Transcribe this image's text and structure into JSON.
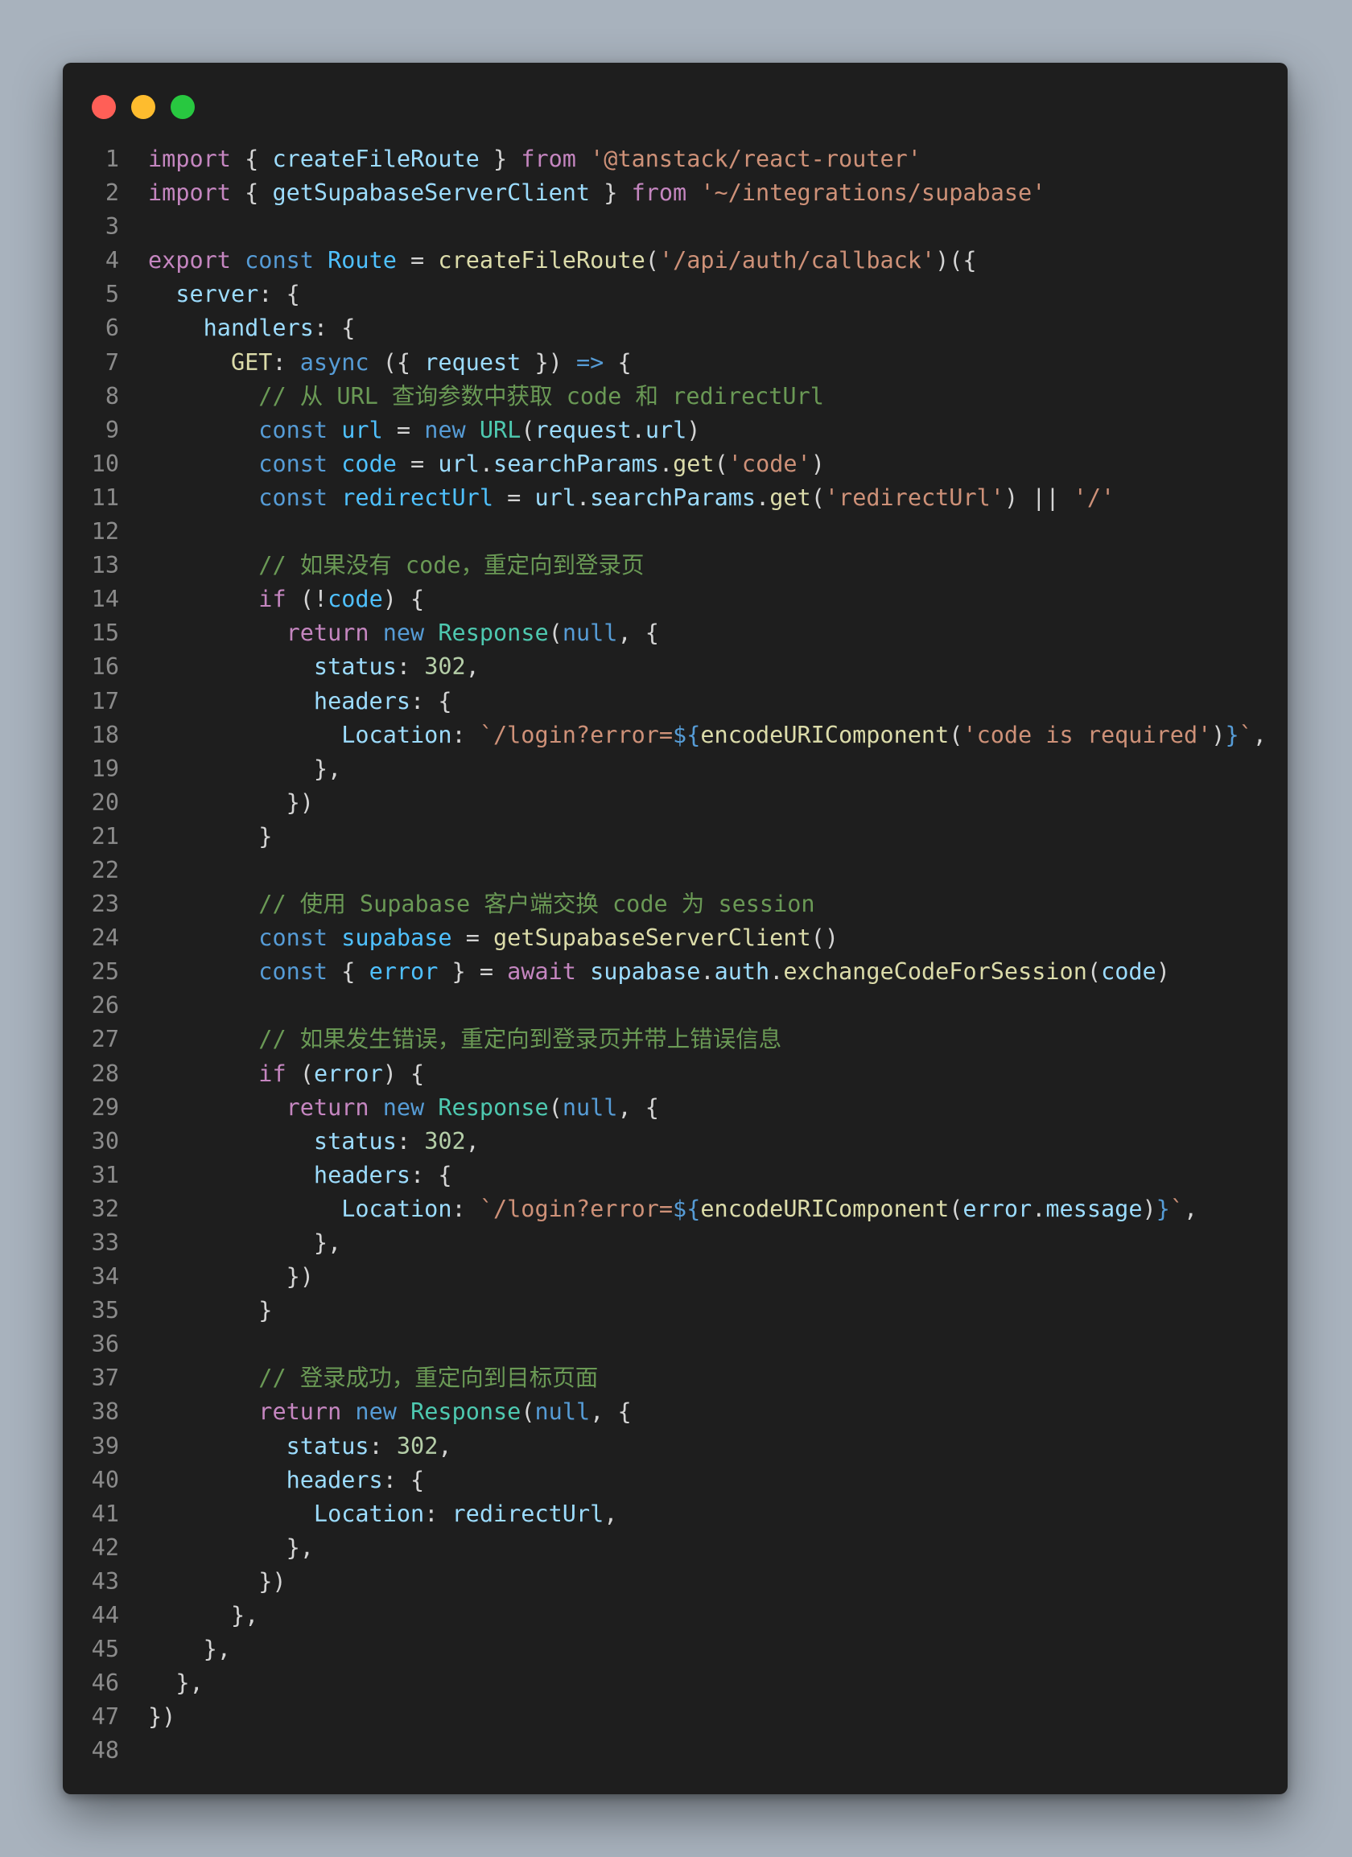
{
  "window": {
    "buttons": [
      {
        "name": "close",
        "color": "#ff5f57"
      },
      {
        "name": "minimize",
        "color": "#febc2e"
      },
      {
        "name": "zoom",
        "color": "#28c840"
      }
    ]
  },
  "editor": {
    "language": "typescript",
    "lines": [
      {
        "n": "1",
        "tokens": [
          [
            "kw",
            "import"
          ],
          [
            "pl",
            " { "
          ],
          [
            "vr",
            "createFileRoute"
          ],
          [
            "pl",
            " } "
          ],
          [
            "kw",
            "from"
          ],
          [
            "pl",
            " "
          ],
          [
            "st",
            "'@tanstack/react-router'"
          ]
        ]
      },
      {
        "n": "2",
        "tokens": [
          [
            "kw",
            "import"
          ],
          [
            "pl",
            " { "
          ],
          [
            "vr",
            "getSupabaseServerClient"
          ],
          [
            "pl",
            " } "
          ],
          [
            "kw",
            "from"
          ],
          [
            "pl",
            " "
          ],
          [
            "st",
            "'~/integrations/supabase'"
          ]
        ]
      },
      {
        "n": "3",
        "tokens": []
      },
      {
        "n": "4",
        "tokens": [
          [
            "kw",
            "export"
          ],
          [
            "pl",
            " "
          ],
          [
            "kb",
            "const"
          ],
          [
            "pl",
            " "
          ],
          [
            "cv",
            "Route"
          ],
          [
            "pl",
            " = "
          ],
          [
            "fn",
            "createFileRoute"
          ],
          [
            "pl",
            "("
          ],
          [
            "st",
            "'/api/auth/callback'"
          ],
          [
            "pl",
            ")({"
          ]
        ]
      },
      {
        "n": "5",
        "tokens": [
          [
            "pl",
            "  "
          ],
          [
            "pr",
            "server"
          ],
          [
            "pl",
            ": {"
          ]
        ]
      },
      {
        "n": "6",
        "tokens": [
          [
            "pl",
            "    "
          ],
          [
            "pr",
            "handlers"
          ],
          [
            "pl",
            ": {"
          ]
        ]
      },
      {
        "n": "7",
        "tokens": [
          [
            "pl",
            "      "
          ],
          [
            "fn",
            "GET"
          ],
          [
            "pl",
            ": "
          ],
          [
            "kb",
            "async"
          ],
          [
            "pl",
            " ({ "
          ],
          [
            "vr",
            "request"
          ],
          [
            "pl",
            " }) "
          ],
          [
            "kb",
            "=>"
          ],
          [
            "pl",
            " {"
          ]
        ]
      },
      {
        "n": "8",
        "tokens": [
          [
            "pl",
            "        "
          ],
          [
            "cm",
            "// 从 URL 查询参数中获取 code 和 redirectUrl"
          ]
        ]
      },
      {
        "n": "9",
        "tokens": [
          [
            "pl",
            "        "
          ],
          [
            "kb",
            "const"
          ],
          [
            "pl",
            " "
          ],
          [
            "cv",
            "url"
          ],
          [
            "pl",
            " = "
          ],
          [
            "kb",
            "new"
          ],
          [
            "pl",
            " "
          ],
          [
            "ty",
            "URL"
          ],
          [
            "pl",
            "("
          ],
          [
            "vr",
            "request"
          ],
          [
            "pl",
            "."
          ],
          [
            "vr",
            "url"
          ],
          [
            "pl",
            ")"
          ]
        ]
      },
      {
        "n": "10",
        "tokens": [
          [
            "pl",
            "        "
          ],
          [
            "kb",
            "const"
          ],
          [
            "pl",
            " "
          ],
          [
            "cv",
            "code"
          ],
          [
            "pl",
            " = "
          ],
          [
            "vr",
            "url"
          ],
          [
            "pl",
            "."
          ],
          [
            "vr",
            "searchParams"
          ],
          [
            "pl",
            "."
          ],
          [
            "fn",
            "get"
          ],
          [
            "pl",
            "("
          ],
          [
            "st",
            "'code'"
          ],
          [
            "pl",
            ")"
          ]
        ]
      },
      {
        "n": "11",
        "tokens": [
          [
            "pl",
            "        "
          ],
          [
            "kb",
            "const"
          ],
          [
            "pl",
            " "
          ],
          [
            "cv",
            "redirectUrl"
          ],
          [
            "pl",
            " = "
          ],
          [
            "vr",
            "url"
          ],
          [
            "pl",
            "."
          ],
          [
            "vr",
            "searchParams"
          ],
          [
            "pl",
            "."
          ],
          [
            "fn",
            "get"
          ],
          [
            "pl",
            "("
          ],
          [
            "st",
            "'redirectUrl'"
          ],
          [
            "pl",
            ") || "
          ],
          [
            "st",
            "'/'"
          ]
        ]
      },
      {
        "n": "12",
        "tokens": []
      },
      {
        "n": "13",
        "tokens": [
          [
            "pl",
            "        "
          ],
          [
            "cm",
            "// 如果没有 code，重定向到登录页"
          ]
        ]
      },
      {
        "n": "14",
        "tokens": [
          [
            "pl",
            "        "
          ],
          [
            "kw",
            "if"
          ],
          [
            "pl",
            " (!"
          ],
          [
            "cv",
            "code"
          ],
          [
            "pl",
            ") {"
          ]
        ]
      },
      {
        "n": "15",
        "tokens": [
          [
            "pl",
            "          "
          ],
          [
            "kw",
            "return"
          ],
          [
            "pl",
            " "
          ],
          [
            "kb",
            "new"
          ],
          [
            "pl",
            " "
          ],
          [
            "ty",
            "Response"
          ],
          [
            "pl",
            "("
          ],
          [
            "kb",
            "null"
          ],
          [
            "pl",
            ", {"
          ]
        ]
      },
      {
        "n": "16",
        "tokens": [
          [
            "pl",
            "            "
          ],
          [
            "pr",
            "status"
          ],
          [
            "pl",
            ": "
          ],
          [
            "nm",
            "302"
          ],
          [
            "pl",
            ","
          ]
        ]
      },
      {
        "n": "17",
        "tokens": [
          [
            "pl",
            "            "
          ],
          [
            "pr",
            "headers"
          ],
          [
            "pl",
            ": {"
          ]
        ]
      },
      {
        "n": "18",
        "tokens": [
          [
            "pl",
            "              "
          ],
          [
            "pr",
            "Location"
          ],
          [
            "pl",
            ": "
          ],
          [
            "st",
            "`/login?error="
          ],
          [
            "kb",
            "${"
          ],
          [
            "fn",
            "encodeURIComponent"
          ],
          [
            "pl",
            "("
          ],
          [
            "st",
            "'code is required'"
          ],
          [
            "pl",
            ")"
          ],
          [
            "kb",
            "}"
          ],
          [
            "st",
            "`"
          ],
          [
            "pl",
            ","
          ]
        ]
      },
      {
        "n": "19",
        "tokens": [
          [
            "pl",
            "            },"
          ]
        ]
      },
      {
        "n": "20",
        "tokens": [
          [
            "pl",
            "          })"
          ]
        ]
      },
      {
        "n": "21",
        "tokens": [
          [
            "pl",
            "        }"
          ]
        ]
      },
      {
        "n": "22",
        "tokens": []
      },
      {
        "n": "23",
        "tokens": [
          [
            "pl",
            "        "
          ],
          [
            "cm",
            "// 使用 Supabase 客户端交换 code 为 session"
          ]
        ]
      },
      {
        "n": "24",
        "tokens": [
          [
            "pl",
            "        "
          ],
          [
            "kb",
            "const"
          ],
          [
            "pl",
            " "
          ],
          [
            "cv",
            "supabase"
          ],
          [
            "pl",
            " = "
          ],
          [
            "fn",
            "getSupabaseServerClient"
          ],
          [
            "pl",
            "()"
          ]
        ]
      },
      {
        "n": "25",
        "tokens": [
          [
            "pl",
            "        "
          ],
          [
            "kb",
            "const"
          ],
          [
            "pl",
            " { "
          ],
          [
            "cv",
            "error"
          ],
          [
            "pl",
            " } = "
          ],
          [
            "kw",
            "await"
          ],
          [
            "pl",
            " "
          ],
          [
            "vr",
            "supabase"
          ],
          [
            "pl",
            "."
          ],
          [
            "vr",
            "auth"
          ],
          [
            "pl",
            "."
          ],
          [
            "fn",
            "exchangeCodeForSession"
          ],
          [
            "pl",
            "("
          ],
          [
            "vr",
            "code"
          ],
          [
            "pl",
            ")"
          ]
        ]
      },
      {
        "n": "26",
        "tokens": []
      },
      {
        "n": "27",
        "tokens": [
          [
            "pl",
            "        "
          ],
          [
            "cm",
            "// 如果发生错误，重定向到登录页并带上错误信息"
          ]
        ]
      },
      {
        "n": "28",
        "tokens": [
          [
            "pl",
            "        "
          ],
          [
            "kw",
            "if"
          ],
          [
            "pl",
            " ("
          ],
          [
            "vr",
            "error"
          ],
          [
            "pl",
            ") {"
          ]
        ]
      },
      {
        "n": "29",
        "tokens": [
          [
            "pl",
            "          "
          ],
          [
            "kw",
            "return"
          ],
          [
            "pl",
            " "
          ],
          [
            "kb",
            "new"
          ],
          [
            "pl",
            " "
          ],
          [
            "ty",
            "Response"
          ],
          [
            "pl",
            "("
          ],
          [
            "kb",
            "null"
          ],
          [
            "pl",
            ", {"
          ]
        ]
      },
      {
        "n": "30",
        "tokens": [
          [
            "pl",
            "            "
          ],
          [
            "pr",
            "status"
          ],
          [
            "pl",
            ": "
          ],
          [
            "nm",
            "302"
          ],
          [
            "pl",
            ","
          ]
        ]
      },
      {
        "n": "31",
        "tokens": [
          [
            "pl",
            "            "
          ],
          [
            "pr",
            "headers"
          ],
          [
            "pl",
            ": {"
          ]
        ]
      },
      {
        "n": "32",
        "tokens": [
          [
            "pl",
            "              "
          ],
          [
            "pr",
            "Location"
          ],
          [
            "pl",
            ": "
          ],
          [
            "st",
            "`/login?error="
          ],
          [
            "kb",
            "${"
          ],
          [
            "fn",
            "encodeURIComponent"
          ],
          [
            "pl",
            "("
          ],
          [
            "vr",
            "error"
          ],
          [
            "pl",
            "."
          ],
          [
            "vr",
            "message"
          ],
          [
            "pl",
            ")"
          ],
          [
            "kb",
            "}"
          ],
          [
            "st",
            "`"
          ],
          [
            "pl",
            ","
          ]
        ]
      },
      {
        "n": "33",
        "tokens": [
          [
            "pl",
            "            },"
          ]
        ]
      },
      {
        "n": "34",
        "tokens": [
          [
            "pl",
            "          })"
          ]
        ]
      },
      {
        "n": "35",
        "tokens": [
          [
            "pl",
            "        }"
          ]
        ]
      },
      {
        "n": "36",
        "tokens": []
      },
      {
        "n": "37",
        "tokens": [
          [
            "pl",
            "        "
          ],
          [
            "cm",
            "// 登录成功，重定向到目标页面"
          ]
        ]
      },
      {
        "n": "38",
        "tokens": [
          [
            "pl",
            "        "
          ],
          [
            "kw",
            "return"
          ],
          [
            "pl",
            " "
          ],
          [
            "kb",
            "new"
          ],
          [
            "pl",
            " "
          ],
          [
            "ty",
            "Response"
          ],
          [
            "pl",
            "("
          ],
          [
            "kb",
            "null"
          ],
          [
            "pl",
            ", {"
          ]
        ]
      },
      {
        "n": "39",
        "tokens": [
          [
            "pl",
            "          "
          ],
          [
            "pr",
            "status"
          ],
          [
            "pl",
            ": "
          ],
          [
            "nm",
            "302"
          ],
          [
            "pl",
            ","
          ]
        ]
      },
      {
        "n": "40",
        "tokens": [
          [
            "pl",
            "          "
          ],
          [
            "pr",
            "headers"
          ],
          [
            "pl",
            ": {"
          ]
        ]
      },
      {
        "n": "41",
        "tokens": [
          [
            "pl",
            "            "
          ],
          [
            "pr",
            "Location"
          ],
          [
            "pl",
            ": "
          ],
          [
            "vr",
            "redirectUrl"
          ],
          [
            "pl",
            ","
          ]
        ]
      },
      {
        "n": "42",
        "tokens": [
          [
            "pl",
            "          },"
          ]
        ]
      },
      {
        "n": "43",
        "tokens": [
          [
            "pl",
            "        })"
          ]
        ]
      },
      {
        "n": "44",
        "tokens": [
          [
            "pl",
            "      },"
          ]
        ]
      },
      {
        "n": "45",
        "tokens": [
          [
            "pl",
            "    },"
          ]
        ]
      },
      {
        "n": "46",
        "tokens": [
          [
            "pl",
            "  },"
          ]
        ]
      },
      {
        "n": "47",
        "tokens": [
          [
            "pl",
            "})"
          ]
        ]
      },
      {
        "n": "48",
        "tokens": []
      }
    ]
  }
}
